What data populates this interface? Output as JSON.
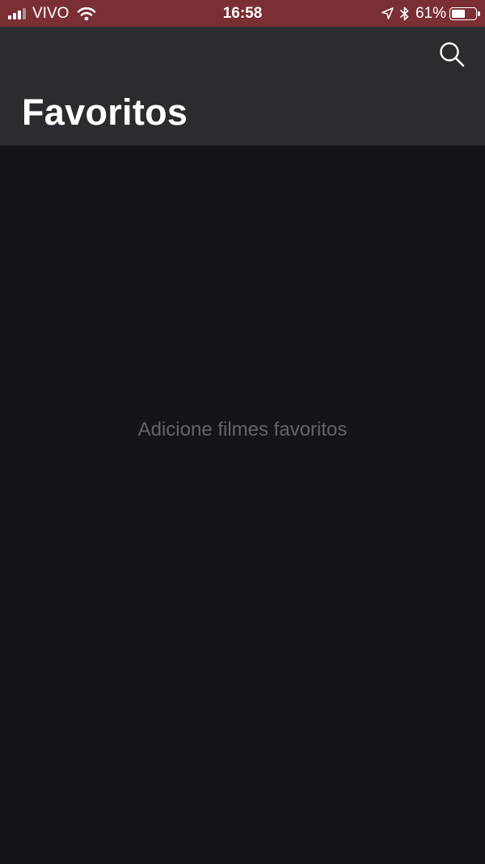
{
  "status_bar": {
    "carrier": "VIVO",
    "time": "16:58",
    "battery_percent": "61%",
    "battery_level": 0.61,
    "signal_bars": 3,
    "icons": [
      "signal-icon",
      "wifi-icon",
      "location-arrow-icon",
      "bluetooth-icon",
      "battery-icon"
    ]
  },
  "header": {
    "title": "Favoritos",
    "search_icon": "search-icon"
  },
  "main": {
    "empty_message": "Adicione filmes favoritos"
  },
  "colors": {
    "status_bar_bg": "#7a2f35",
    "header_bg": "#2b2c30",
    "content_bg": "#14151b",
    "title_text": "#ffffff",
    "empty_text": "#63646a"
  }
}
